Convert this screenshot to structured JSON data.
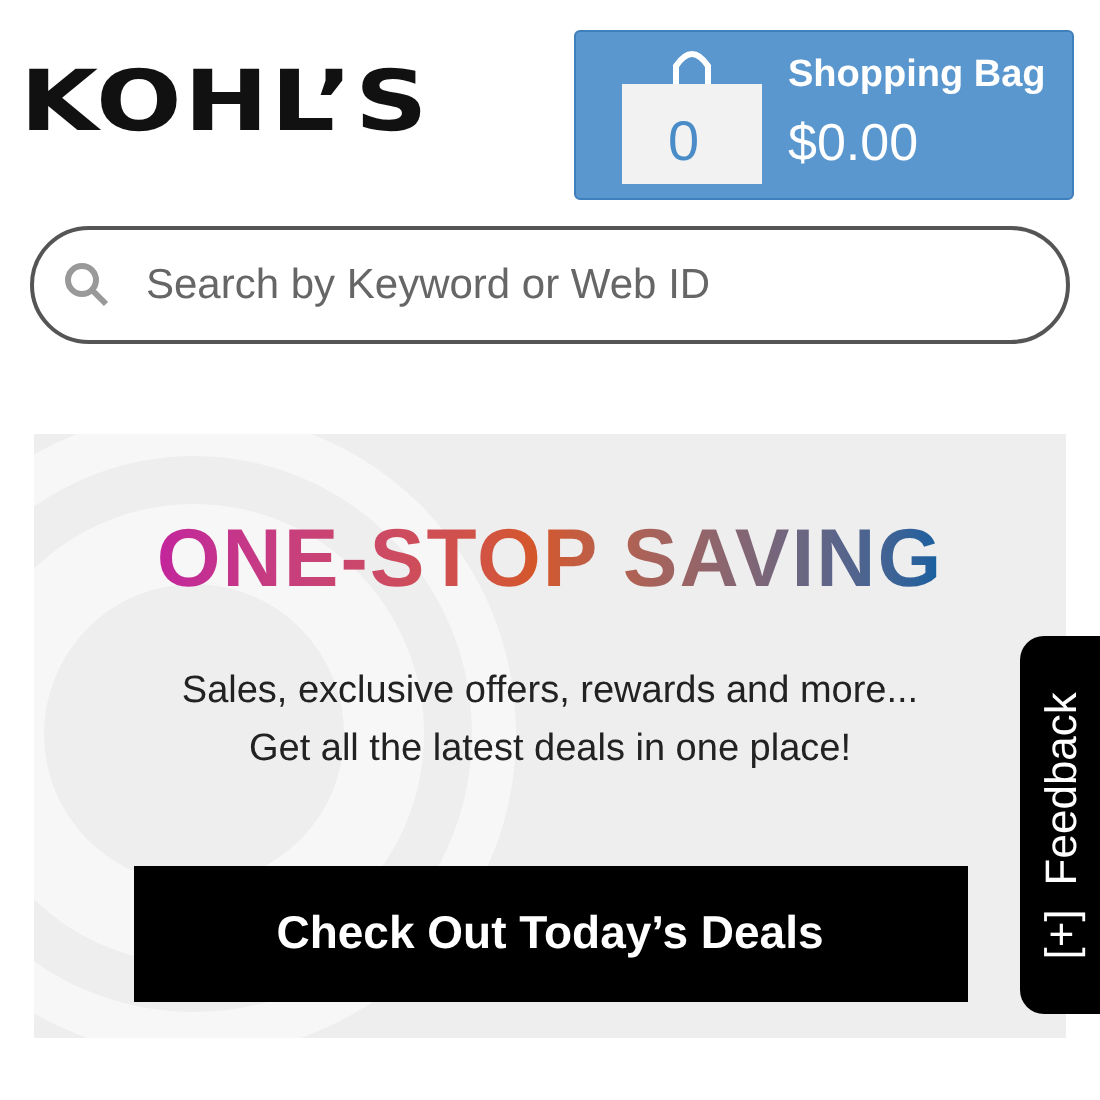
{
  "header": {
    "logo": "KOHL’S",
    "shopping_bag": {
      "count": "0",
      "title": "Shopping Bag",
      "total": "$0.00"
    }
  },
  "search": {
    "placeholder": "Search by Keyword or Web ID"
  },
  "banner": {
    "headline": "ONE-STOP SAVING",
    "lines": [
      "Sales, exclusive offers, rewards and more...",
      "Get all the latest deals in one place!"
    ],
    "button": "Check Out Today’s Deals"
  },
  "feedback_tab": {
    "label": "Feedback",
    "icon_text": "[+]"
  }
}
